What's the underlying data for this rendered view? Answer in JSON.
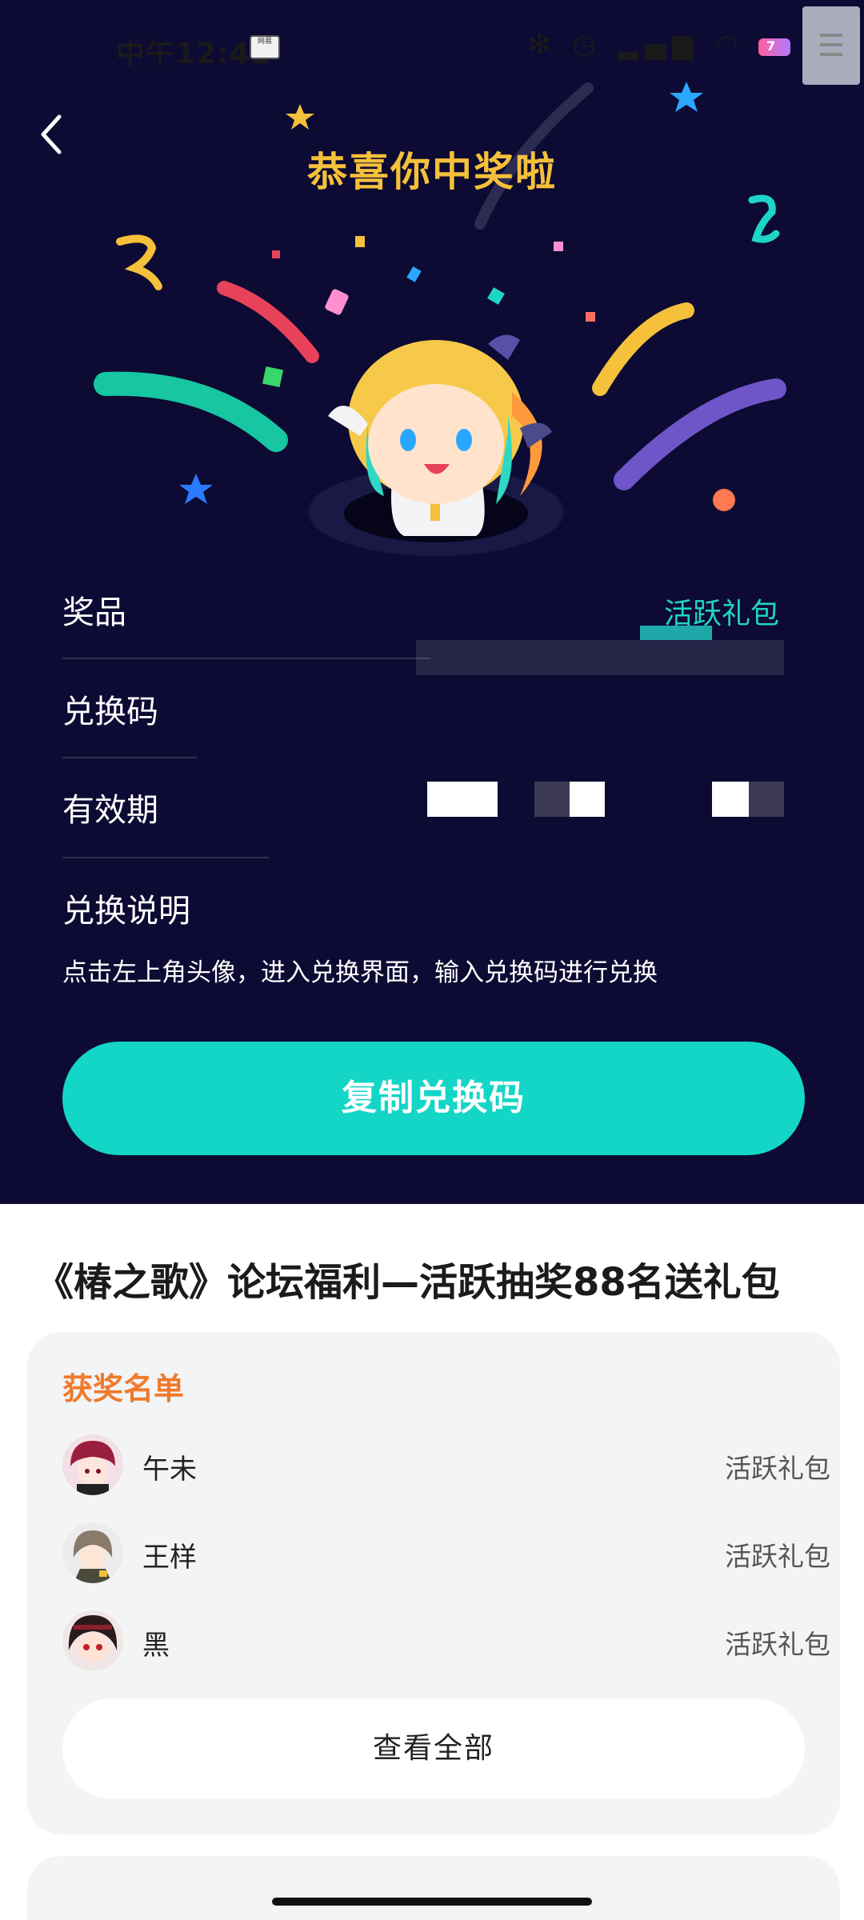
{
  "status_bar": {
    "time": "中午12:41",
    "app_badge": "网易",
    "battery_level": "7",
    "icons": [
      "nfc-icon",
      "alarm-icon",
      "signal-icon",
      "wifi-icon",
      "battery-icon"
    ]
  },
  "header": {
    "title": "恭喜你中奖啦"
  },
  "prize_info": {
    "prize_label": "奖品",
    "prize_value": "活跃礼包",
    "code_label": "兑换码",
    "validity_label": "有效期",
    "instructions_label": "兑换说明",
    "instructions_text": "点击左上角头像，进入兑换界面，输入兑换码进行兑换"
  },
  "actions": {
    "copy_code": "复制兑换码"
  },
  "event": {
    "title": "《椿之歌》论坛福利—活跃抽奖88名送礼包"
  },
  "winners": {
    "heading": "获奖名单",
    "list": [
      {
        "name": "午未",
        "prize": "活跃礼包"
      },
      {
        "name": "王样",
        "prize": "活跃礼包"
      },
      {
        "name": "黑",
        "prize": "活跃礼包"
      }
    ],
    "view_all": "查看全部"
  },
  "colors": {
    "background_dark": "#0d0a33",
    "accent_teal": "#14d6c6",
    "title_gold": "#f5c03a",
    "winners_orange": "#f07a2a"
  }
}
